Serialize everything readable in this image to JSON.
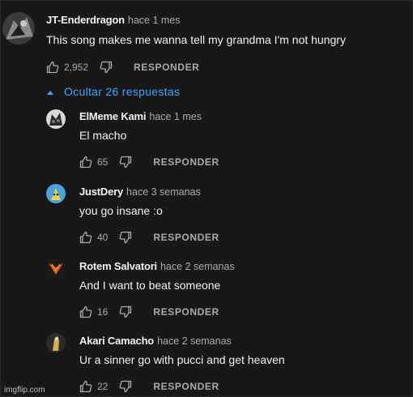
{
  "top_comment": {
    "author": "JT-Enderdragon",
    "time": "hace 1 mes",
    "text": "This song makes me wanna tell my grandma I'm not hungry",
    "likes": "2,952",
    "reply_label": "RESPONDER"
  },
  "replies_toggle": {
    "label": "Ocultar 26 respuestas",
    "icon": "chevron-up-icon"
  },
  "replies": [
    {
      "author": "ElMeme Kami",
      "time": "hace 1 mes",
      "text": "El macho",
      "likes": "65",
      "reply_label": "RESPONDER"
    },
    {
      "author": "JustDery",
      "time": "hace 3 semanas",
      "text": "you go insane :o",
      "likes": "40",
      "reply_label": "RESPONDER"
    },
    {
      "author": "Rotem Salvatori",
      "time": "hace 2 semanas",
      "text": "And I want to beat someone",
      "likes": "16",
      "reply_label": "RESPONDER"
    },
    {
      "author": "Akari Camacho",
      "time": "hace 2 semanas",
      "text": "Ur a sinner go with pucci and get heaven",
      "likes": "22",
      "reply_label": "RESPONDER"
    }
  ],
  "watermark": "imgflip.com",
  "colors": {
    "background": "#181818",
    "link": "#3ea6ff",
    "secondary_text": "#aaaaaa",
    "primary_text": "#f1f1f1"
  }
}
